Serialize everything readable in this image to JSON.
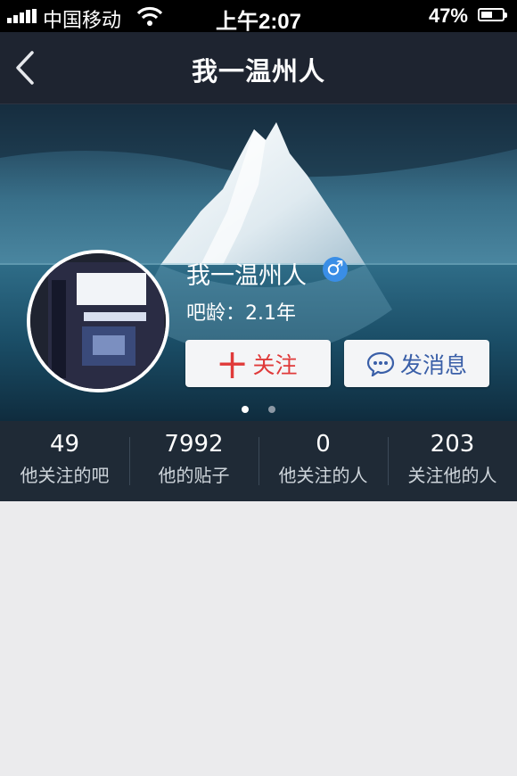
{
  "status_bar": {
    "carrier": "中国移动",
    "time": "上午2:07",
    "battery_percent": "47%",
    "battery_level": 0.47,
    "icons": [
      "signal-icon",
      "wifi-icon",
      "battery-icon"
    ]
  },
  "nav": {
    "title": "我一温州人",
    "back_icon": "chevron-left-icon"
  },
  "profile": {
    "name": "我一温州人",
    "gender_symbol": "♂",
    "gender_color": "#3a8ee6",
    "bar_age": "吧龄：2.1年",
    "follow_icon": "十",
    "follow_label": "关注",
    "follow_color": "#e03a3a",
    "message_label": "发消息",
    "message_icon": "chat-bubble-icon",
    "message_color": "#3a5fa8",
    "carousel_total": 2,
    "carousel_active": 1
  },
  "stats": [
    {
      "value": "49",
      "label": "他关注的吧"
    },
    {
      "value": "7992",
      "label": "他的贴子"
    },
    {
      "value": "0",
      "label": "他关注的人"
    },
    {
      "value": "203",
      "label": "关注他的人"
    }
  ]
}
